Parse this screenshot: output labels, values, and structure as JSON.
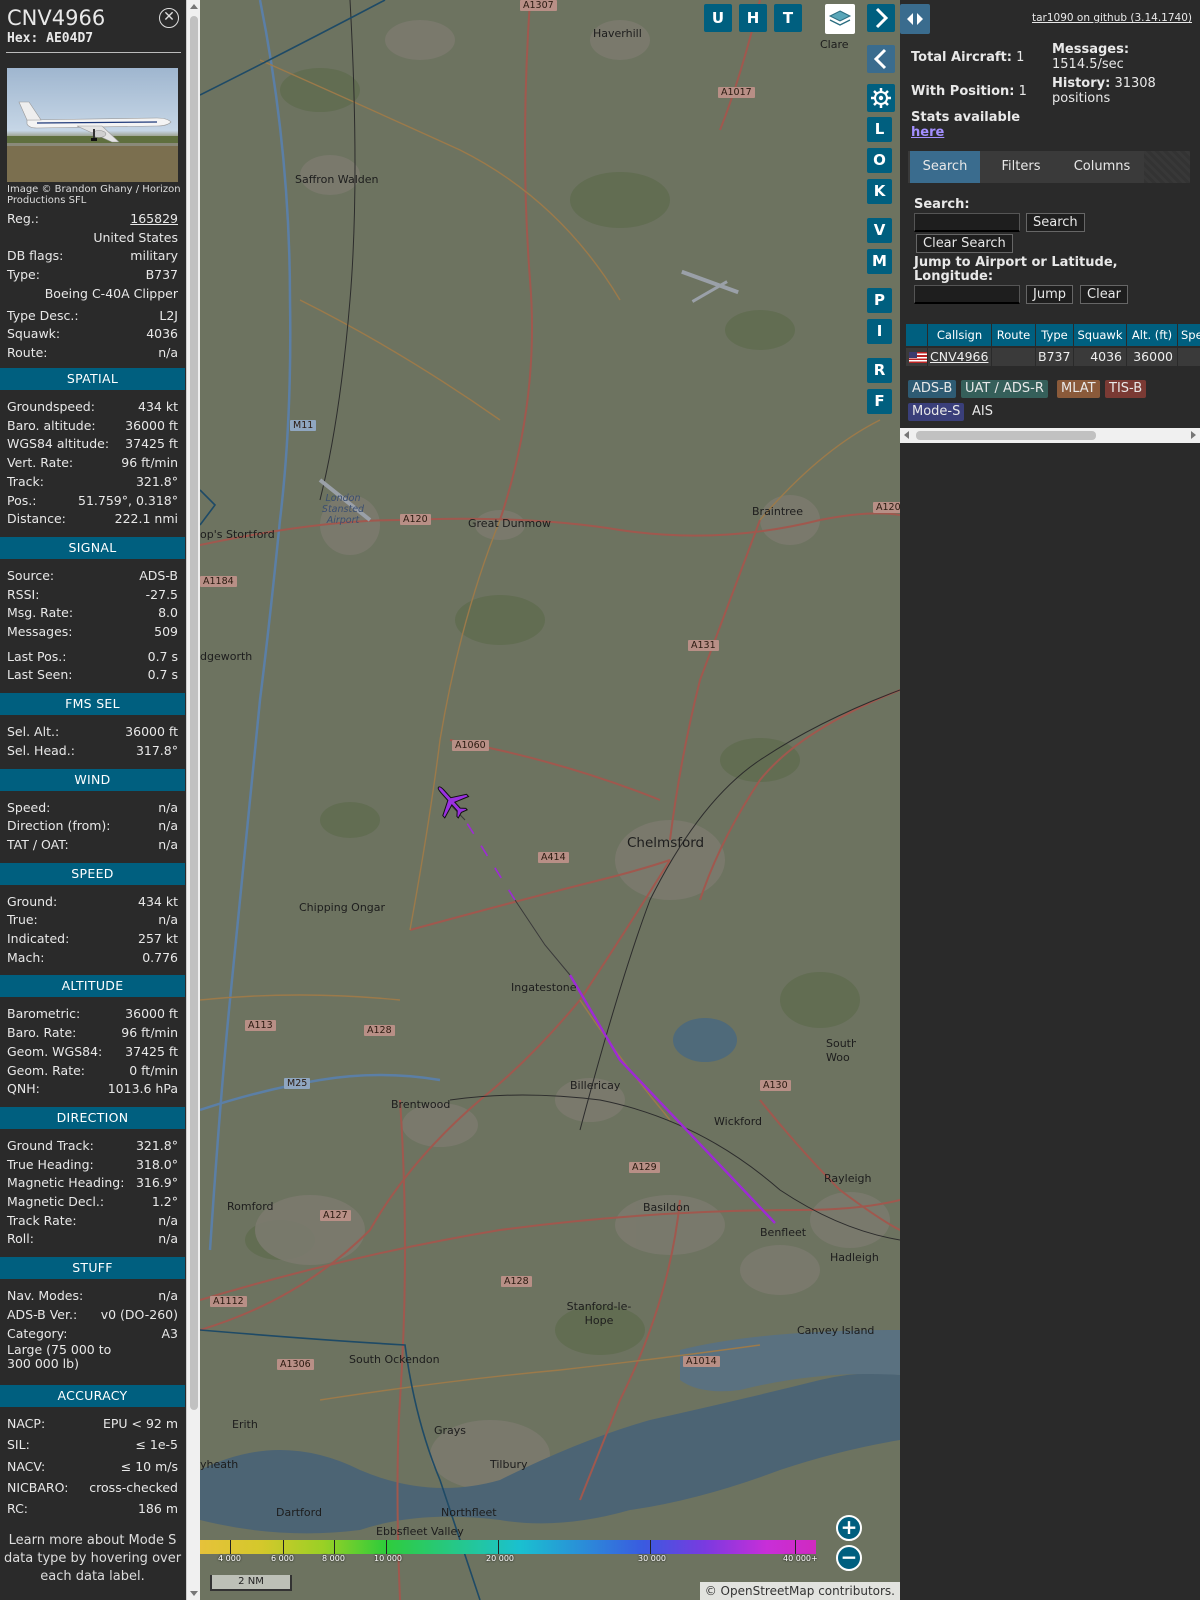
{
  "info": {
    "callsign": "CNV4966",
    "hex": "Hex: AE04D7",
    "close_icon": "close-icon",
    "photo_credit": "Image © Brandon Ghany / Horizon Productions SFL",
    "top_rows": [
      {
        "k": "Reg.:",
        "v": "165829"
      },
      {
        "k": "",
        "v": "United States"
      },
      {
        "k": "DB flags:",
        "v": "military"
      },
      {
        "k": "Type:",
        "v": "B737"
      },
      {
        "k": "",
        "v": "Boeing C-40A Clipper"
      },
      {
        "k": "Type Desc.:",
        "v": "L2J"
      },
      {
        "k": "Squawk:",
        "v": "4036"
      },
      {
        "k": "Route:",
        "v": "n/a"
      }
    ],
    "sections": [
      {
        "title": "SPATIAL",
        "rows": [
          {
            "k": "Groundspeed:",
            "v": "434 kt"
          },
          {
            "k": "Baro. altitude:",
            "v": "36000 ft"
          },
          {
            "k": "WGS84 altitude:",
            "v": "37425 ft"
          },
          {
            "k": "Vert. Rate:",
            "v": "96 ft/min"
          },
          {
            "k": "Track:",
            "v": "321.8°"
          },
          {
            "k": "Pos.:",
            "v": "51.759°, 0.318°"
          },
          {
            "k": "Distance:",
            "v": "222.1 nmi"
          }
        ]
      },
      {
        "title": "SIGNAL",
        "rows": [
          {
            "k": "Source:",
            "v": "ADS-B"
          },
          {
            "k": "RSSI:",
            "v": "-27.5"
          },
          {
            "k": "Msg. Rate:",
            "v": "8.0"
          },
          {
            "k": "Messages:",
            "v": "509"
          },
          {
            "k": "Last Pos.:",
            "v": "0.7 s"
          },
          {
            "k": "Last Seen:",
            "v": "0.7 s"
          }
        ]
      },
      {
        "title": "FMS SEL",
        "rows": [
          {
            "k": "Sel. Alt.:",
            "v": "36000 ft"
          },
          {
            "k": "Sel. Head.:",
            "v": "317.8°"
          }
        ]
      },
      {
        "title": "WIND",
        "rows": [
          {
            "k": "Speed:",
            "v": "n/a"
          },
          {
            "k": "Direction (from):",
            "v": "n/a"
          },
          {
            "k": "TAT / OAT:",
            "v": "n/a"
          }
        ]
      },
      {
        "title": "SPEED",
        "rows": [
          {
            "k": "Ground:",
            "v": "434 kt"
          },
          {
            "k": "True:",
            "v": "n/a"
          },
          {
            "k": "Indicated:",
            "v": "257 kt"
          },
          {
            "k": "Mach:",
            "v": "0.776"
          }
        ]
      },
      {
        "title": "ALTITUDE",
        "rows": [
          {
            "k": "Barometric:",
            "v": "36000 ft"
          },
          {
            "k": "Baro. Rate:",
            "v": "96 ft/min"
          },
          {
            "k": "Geom. WGS84:",
            "v": "37425 ft"
          },
          {
            "k": "Geom. Rate:",
            "v": "0 ft/min"
          },
          {
            "k": "QNH:",
            "v": "1013.6 hPa"
          }
        ]
      },
      {
        "title": "DIRECTION",
        "rows": [
          {
            "k": "Ground Track:",
            "v": "321.8°"
          },
          {
            "k": "True Heading:",
            "v": "318.0°"
          },
          {
            "k": "Magnetic Heading:",
            "v": "316.9°"
          },
          {
            "k": "Magnetic Decl.:",
            "v": "1.2°"
          },
          {
            "k": "Track Rate:",
            "v": "n/a"
          },
          {
            "k": "Roll:",
            "v": "n/a"
          }
        ]
      },
      {
        "title": "STUFF",
        "rows": [
          {
            "k": "Nav. Modes:",
            "v": "n/a"
          },
          {
            "k": "ADS-B Ver.:",
            "v": "v0 (DO-260)"
          },
          {
            "k": "Category:",
            "v": "A3"
          },
          {
            "k": "Large (75 000 to 300 000 lb)",
            "v": ""
          }
        ]
      },
      {
        "title": "ACCURACY",
        "rows": [
          {
            "k": "NACP:",
            "v": "EPU < 92 m"
          },
          {
            "k": "SIL:",
            "v": "≤ 1e-5"
          },
          {
            "k": "NACV:",
            "v": "≤ 10 m/s"
          },
          {
            "k": "NICBARO:",
            "v": "cross-checked"
          },
          {
            "k": "RC:",
            "v": "186 m"
          }
        ]
      }
    ],
    "footnote": "Learn more about Mode S data type by hovering over each data label."
  },
  "map": {
    "top_buttons": [
      "U",
      "H",
      "T"
    ],
    "side_buttons": [
      "L",
      "O",
      "K",
      "V",
      "M",
      "P",
      "I",
      "R",
      "F"
    ],
    "places": [
      {
        "name": "Haverhill",
        "big": false
      },
      {
        "name": "Clare",
        "big": false
      },
      {
        "name": "Saffron Walden",
        "big": false
      },
      {
        "name": "Great Dunmow",
        "big": false
      },
      {
        "name": "Braintree",
        "big": false
      },
      {
        "name": "op's Stortford",
        "big": false
      },
      {
        "name": "London Stansted Airport",
        "big": false
      },
      {
        "name": "dgeworth",
        "big": false
      },
      {
        "name": "Chelmsford",
        "big": true
      },
      {
        "name": "Chipping Ongar",
        "big": false
      },
      {
        "name": "Ingatestone",
        "big": false
      },
      {
        "name": "Billericay",
        "big": false
      },
      {
        "name": "Brentwood",
        "big": false
      },
      {
        "name": "Wickford",
        "big": false
      },
      {
        "name": "Rayleigh",
        "big": false
      },
      {
        "name": "Romford",
        "big": false
      },
      {
        "name": "Basildon",
        "big": false
      },
      {
        "name": "Benfleet",
        "big": false
      },
      {
        "name": "Hadleigh",
        "big": false
      },
      {
        "name": "South Woo Ferrer",
        "big": false
      },
      {
        "name": "Canvey Island",
        "big": false
      },
      {
        "name": "Stanford-le-Hope",
        "big": false
      },
      {
        "name": "South Ockendon",
        "big": false
      },
      {
        "name": "Grays",
        "big": false
      },
      {
        "name": "Tilbury",
        "big": false
      },
      {
        "name": "Erith",
        "big": false
      },
      {
        "name": "yheath",
        "big": false
      },
      {
        "name": "Dartford",
        "big": false
      },
      {
        "name": "Ebbsfleet Valley",
        "big": false
      },
      {
        "name": "Northfleet",
        "big": false
      }
    ],
    "roads": [
      "A1307",
      "A1017",
      "M11",
      "A120",
      "A120",
      "A1184",
      "A131",
      "A1060",
      "A414",
      "A113",
      "A128",
      "M25",
      "A130",
      "A129",
      "A127",
      "A128",
      "A1112",
      "A1306",
      "A1014"
    ],
    "colorbar_ticks": [
      "4 000",
      "6 000",
      "8 000",
      "10 000",
      "20 000",
      "30 000",
      "40 000+"
    ],
    "scale": "2 NM",
    "attribution_prefix": "© ",
    "attribution_link": "OpenStreetMap",
    "attribution_suffix": " contributors.",
    "zoom_in": "+",
    "zoom_out": "−"
  },
  "right": {
    "github": "tar1090 on github (3.14.1740)",
    "total_aircraft_label": "Total Aircraft:",
    "total_aircraft": "1",
    "with_position_label": "With Position:",
    "with_position": "1",
    "stats_label": "Stats available",
    "stats_link": "here",
    "messages_label": "Messages:",
    "messages": "1514.5/sec",
    "history_label": "History:",
    "history": "31308 positions",
    "tabs": [
      "Search",
      "Filters",
      "Columns"
    ],
    "search_label": "Search:",
    "search_value": "",
    "search_button": "Search",
    "clear_search_button": "Clear Search",
    "jump_label": "Jump to Airport or Latitude, Longitude:",
    "jump_value": "",
    "jump_button": "Jump",
    "clear_button": "Clear",
    "table": {
      "headers": [
        "",
        "Callsign",
        "Route",
        "Type",
        "Squawk",
        "Alt. (ft)",
        "Spe"
      ],
      "rows": [
        {
          "callsign": "CNV4966",
          "route": "",
          "type": "B737",
          "squawk": "4036",
          "alt": "36000",
          "speed": ""
        }
      ]
    },
    "legend": [
      {
        "label": "ADS-B",
        "color": "#2e5b73"
      },
      {
        "label": "UAT / ADS-R",
        "color": "#355f5a"
      },
      {
        "label": "MLAT",
        "color": "#8a5a3a"
      },
      {
        "label": "TIS-B",
        "color": "#7a3a34"
      },
      {
        "label": "Mode-S",
        "color": "#3a3f7a"
      },
      {
        "label": "AIS",
        "color": "#2a2a2a"
      }
    ]
  }
}
